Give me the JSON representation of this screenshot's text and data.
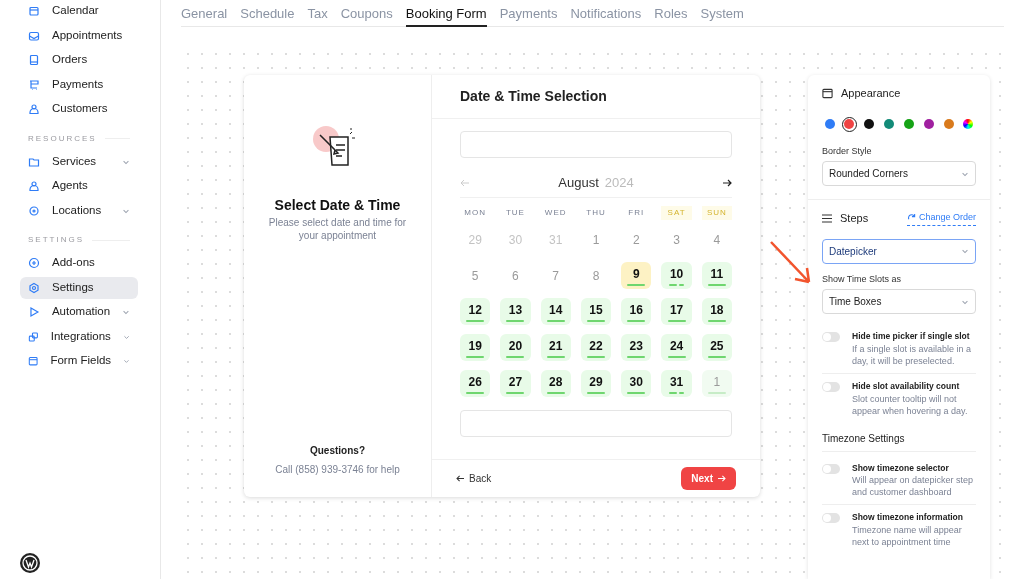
{
  "sidebar": {
    "items": [
      {
        "label": "Calendar",
        "expandable": false,
        "selected": false
      },
      {
        "label": "Appointments",
        "expandable": false,
        "selected": false
      },
      {
        "label": "Orders",
        "expandable": false,
        "selected": false
      },
      {
        "label": "Payments",
        "expandable": false,
        "selected": false
      },
      {
        "label": "Customers",
        "expandable": false,
        "selected": false
      }
    ],
    "sections": [
      {
        "title": "RESOURCES",
        "items": [
          {
            "label": "Services",
            "expandable": true,
            "selected": false
          },
          {
            "label": "Agents",
            "expandable": false,
            "selected": false
          },
          {
            "label": "Locations",
            "expandable": true,
            "selected": false
          }
        ]
      },
      {
        "title": "SETTINGS",
        "items": [
          {
            "label": "Add-ons",
            "expandable": false,
            "selected": false
          },
          {
            "label": "Settings",
            "expandable": false,
            "selected": true
          },
          {
            "label": "Automation",
            "expandable": true,
            "selected": false
          },
          {
            "label": "Integrations",
            "expandable": true,
            "selected": false
          },
          {
            "label": "Form Fields",
            "expandable": true,
            "selected": false
          }
        ]
      }
    ]
  },
  "tabs": [
    {
      "label": "General",
      "selected": false
    },
    {
      "label": "Schedule",
      "selected": false
    },
    {
      "label": "Tax",
      "selected": false
    },
    {
      "label": "Coupons",
      "selected": false
    },
    {
      "label": "Booking Form",
      "selected": true
    },
    {
      "label": "Payments",
      "selected": false
    },
    {
      "label": "Notifications",
      "selected": false
    },
    {
      "label": "Roles",
      "selected": false
    },
    {
      "label": "System",
      "selected": false
    }
  ],
  "booking": {
    "side": {
      "title": "Select Date & Time",
      "subtitle": "Please select date and time for your appointment",
      "questions": "Questions?",
      "help": "Call (858) 939-3746 for help"
    },
    "step_title": "Date & Time Selection",
    "month": "August",
    "year": "2024",
    "weekdays": [
      {
        "label": "MON",
        "weekend": false
      },
      {
        "label": "TUE",
        "weekend": false
      },
      {
        "label": "WED",
        "weekend": false
      },
      {
        "label": "THU",
        "weekend": false
      },
      {
        "label": "FRI",
        "weekend": false
      },
      {
        "label": "SAT",
        "weekend": true
      },
      {
        "label": "SUN",
        "weekend": true
      }
    ],
    "days": [
      {
        "label": "29",
        "kind": "other"
      },
      {
        "label": "30",
        "kind": "other"
      },
      {
        "label": "31",
        "kind": "other"
      },
      {
        "label": "1",
        "kind": "past"
      },
      {
        "label": "2",
        "kind": "past"
      },
      {
        "label": "3",
        "kind": "past"
      },
      {
        "label": "4",
        "kind": "past"
      },
      {
        "label": "5",
        "kind": "past"
      },
      {
        "label": "6",
        "kind": "past"
      },
      {
        "label": "7",
        "kind": "past"
      },
      {
        "label": "8",
        "kind": "past"
      },
      {
        "label": "9",
        "kind": "today"
      },
      {
        "label": "10",
        "kind": "partial"
      },
      {
        "label": "11",
        "kind": "available"
      },
      {
        "label": "12",
        "kind": "available"
      },
      {
        "label": "13",
        "kind": "available"
      },
      {
        "label": "14",
        "kind": "available"
      },
      {
        "label": "15",
        "kind": "available"
      },
      {
        "label": "16",
        "kind": "available"
      },
      {
        "label": "17",
        "kind": "available"
      },
      {
        "label": "18",
        "kind": "available"
      },
      {
        "label": "19",
        "kind": "available"
      },
      {
        "label": "20",
        "kind": "available"
      },
      {
        "label": "21",
        "kind": "available"
      },
      {
        "label": "22",
        "kind": "available"
      },
      {
        "label": "23",
        "kind": "available"
      },
      {
        "label": "24",
        "kind": "available"
      },
      {
        "label": "25",
        "kind": "available"
      },
      {
        "label": "26",
        "kind": "available"
      },
      {
        "label": "27",
        "kind": "available"
      },
      {
        "label": "28",
        "kind": "available"
      },
      {
        "label": "29",
        "kind": "available"
      },
      {
        "label": "30",
        "kind": "available"
      },
      {
        "label": "31",
        "kind": "partial"
      },
      {
        "label": "1",
        "kind": "next"
      }
    ],
    "back": "Back",
    "next": "Next"
  },
  "panel": {
    "appearance": "Appearance",
    "colors": [
      {
        "color": "#2f7cf6",
        "selected": false,
        "kind": "solid"
      },
      {
        "color": "#ef4444",
        "selected": true,
        "kind": "solid"
      },
      {
        "color": "#111111",
        "selected": false,
        "kind": "solid"
      },
      {
        "color": "#138b78",
        "selected": false,
        "kind": "solid"
      },
      {
        "color": "#16a316",
        "selected": false,
        "kind": "solid"
      },
      {
        "color": "#a020a0",
        "selected": false,
        "kind": "solid"
      },
      {
        "color": "#d97a1c",
        "selected": false,
        "kind": "solid"
      },
      {
        "selected": false,
        "kind": "rainbow"
      }
    ],
    "border_label": "Border Style",
    "border_value": "Rounded Corners",
    "steps": "Steps",
    "change_order": "Change Order",
    "step_value": "Datepicker",
    "slots_label": "Show Time Slots as",
    "slots_value": "Time Boxes",
    "toggles": [
      {
        "title": "Hide time picker if single slot",
        "description": "If a single slot is available in a day, it will be preselected.",
        "on": false
      },
      {
        "title": "Hide slot availability count",
        "description": "Slot counter tooltip will not appear when hovering a day.",
        "on": false
      }
    ],
    "timezone": "Timezone Settings",
    "timezone_toggles": [
      {
        "title": "Show timezone selector",
        "description": "Will appear on datepicker step and customer dashboard",
        "on": false
      },
      {
        "title": "Show timezone information",
        "description": "Timezone name will appear next to appointment time",
        "on": false
      }
    ]
  }
}
